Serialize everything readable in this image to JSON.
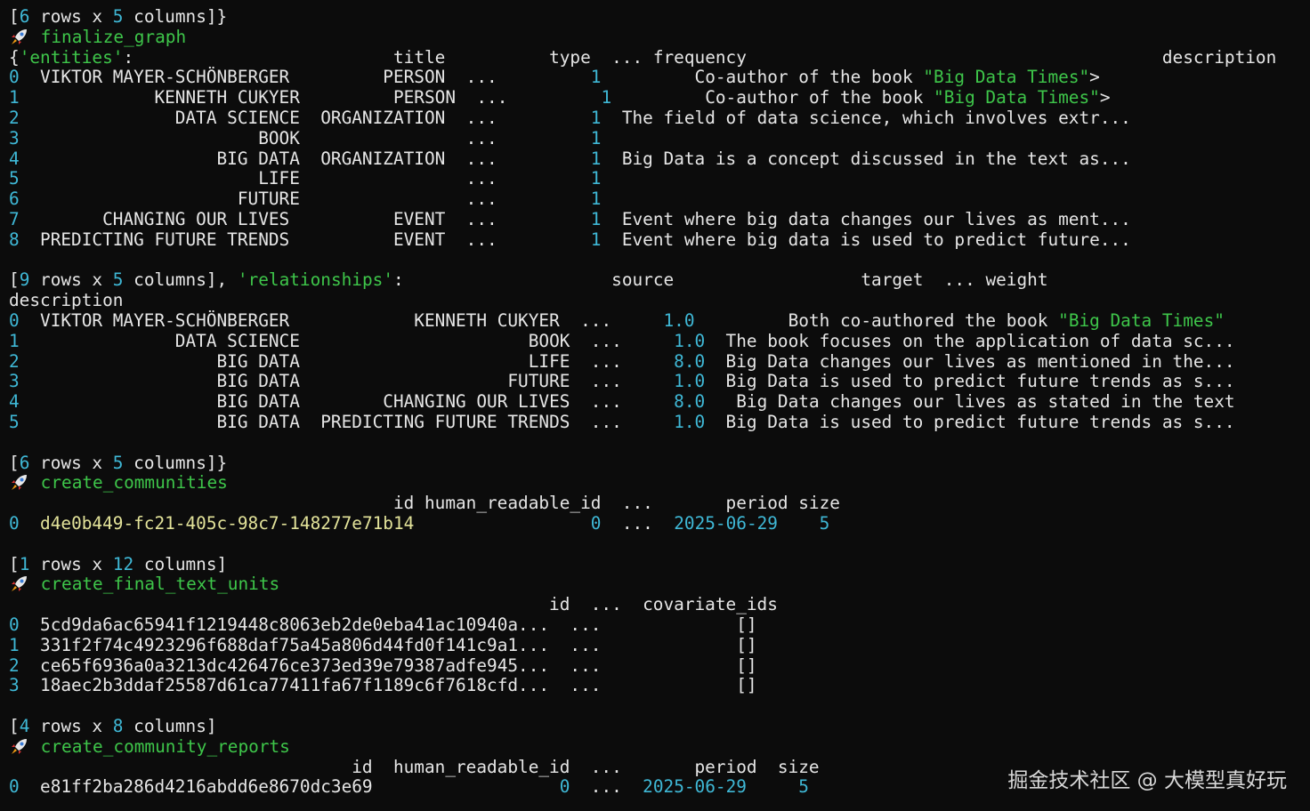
{
  "lines": [
    [
      [
        "d",
        "["
      ],
      [
        "c",
        "6"
      ],
      [
        "d",
        " rows x "
      ],
      [
        "c",
        "5"
      ],
      [
        "d",
        " columns]}"
      ]
    ],
    [
      [
        "icon",
        "rocket-icon"
      ],
      [
        "g",
        " finalize_graph"
      ]
    ],
    [
      [
        "d",
        "{"
      ],
      [
        "g",
        "'entities'"
      ],
      [
        "d",
        ":                         title          type  ... frequency                                        description"
      ]
    ],
    [
      [
        "c",
        "0"
      ],
      [
        "d",
        "  VIKTOR MAYER-SCHÖNBERGER         PERSON  ...         "
      ],
      [
        "c",
        "1"
      ],
      [
        "d",
        "         Co-author of the book "
      ],
      [
        "g",
        "\"Big Data Times\""
      ],
      [
        "d",
        ">"
      ]
    ],
    [
      [
        "c",
        "1"
      ],
      [
        "d",
        "             KENNETH CUKYER         PERSON  ...         "
      ],
      [
        "c",
        "1"
      ],
      [
        "d",
        "         Co-author of the book "
      ],
      [
        "g",
        "\"Big Data Times\""
      ],
      [
        "d",
        ">"
      ]
    ],
    [
      [
        "c",
        "2"
      ],
      [
        "d",
        "               DATA SCIENCE  ORGANIZATION  ...         "
      ],
      [
        "c",
        "1"
      ],
      [
        "d",
        "  The field of data science, which involves extr..."
      ]
    ],
    [
      [
        "c",
        "3"
      ],
      [
        "d",
        "                       BOOK                ...         "
      ],
      [
        "c",
        "1"
      ]
    ],
    [
      [
        "c",
        "4"
      ],
      [
        "d",
        "                   BIG DATA  ORGANIZATION  ...         "
      ],
      [
        "c",
        "1"
      ],
      [
        "d",
        "  Big Data is a concept discussed in the text as..."
      ]
    ],
    [
      [
        "c",
        "5"
      ],
      [
        "d",
        "                       LIFE                ...         "
      ],
      [
        "c",
        "1"
      ]
    ],
    [
      [
        "c",
        "6"
      ],
      [
        "d",
        "                     FUTURE                ...         "
      ],
      [
        "c",
        "1"
      ]
    ],
    [
      [
        "c",
        "7"
      ],
      [
        "d",
        "        CHANGING OUR LIVES          EVENT  ...         "
      ],
      [
        "c",
        "1"
      ],
      [
        "d",
        "  Event where big data changes our lives as ment..."
      ]
    ],
    [
      [
        "c",
        "8"
      ],
      [
        "d",
        "  PREDICTING FUTURE TRENDS          EVENT  ...         "
      ],
      [
        "c",
        "1"
      ],
      [
        "d",
        "  Event where big data is used to predict future..."
      ]
    ],
    [],
    [
      [
        "d",
        "["
      ],
      [
        "c",
        "9"
      ],
      [
        "d",
        " rows x "
      ],
      [
        "c",
        "5"
      ],
      [
        "d",
        " columns], "
      ],
      [
        "g",
        "'relationships'"
      ],
      [
        "d",
        ":                    source                  target  ... weight"
      ]
    ],
    [
      [
        "d",
        "description"
      ]
    ],
    [
      [
        "c",
        "0"
      ],
      [
        "d",
        "  VIKTOR MAYER-SCHÖNBERGER            KENNETH CUKYER  ...     "
      ],
      [
        "c",
        "1.0"
      ],
      [
        "d",
        "         Both co-authored the book "
      ],
      [
        "g",
        "\"Big Data Times\""
      ]
    ],
    [
      [
        "c",
        "1"
      ],
      [
        "d",
        "               DATA SCIENCE                      BOOK  ...     "
      ],
      [
        "c",
        "1.0"
      ],
      [
        "d",
        "  The book focuses on the application of data sc..."
      ]
    ],
    [
      [
        "c",
        "2"
      ],
      [
        "d",
        "                   BIG DATA                      LIFE  ...     "
      ],
      [
        "c",
        "8.0"
      ],
      [
        "d",
        "  Big Data changes our lives as mentioned in the..."
      ]
    ],
    [
      [
        "c",
        "3"
      ],
      [
        "d",
        "                   BIG DATA                    FUTURE  ...     "
      ],
      [
        "c",
        "1.0"
      ],
      [
        "d",
        "  Big Data is used to predict future trends as s..."
      ]
    ],
    [
      [
        "c",
        "4"
      ],
      [
        "d",
        "                   BIG DATA        CHANGING OUR LIVES  ...     "
      ],
      [
        "c",
        "8.0"
      ],
      [
        "d",
        "   Big Data changes our lives as stated in the text"
      ]
    ],
    [
      [
        "c",
        "5"
      ],
      [
        "d",
        "                   BIG DATA  PREDICTING FUTURE TRENDS  ...     "
      ],
      [
        "c",
        "1.0"
      ],
      [
        "d",
        "  Big Data is used to predict future trends as s..."
      ]
    ],
    [],
    [
      [
        "d",
        "["
      ],
      [
        "c",
        "6"
      ],
      [
        "d",
        " rows x "
      ],
      [
        "c",
        "5"
      ],
      [
        "d",
        " columns]}"
      ]
    ],
    [
      [
        "icon",
        "rocket-icon"
      ],
      [
        "g",
        " create_communities"
      ]
    ],
    [
      [
        "d",
        "                                     id human_readable_id  ...       period size"
      ]
    ],
    [
      [
        "c",
        "0"
      ],
      [
        "d",
        "  "
      ],
      [
        "y",
        "d4e0b449-fc21-405c-98c7-148277e71b14"
      ],
      [
        "d",
        "                 "
      ],
      [
        "c",
        "0"
      ],
      [
        "d",
        "  ...  "
      ],
      [
        "c",
        "2025-06-29"
      ],
      [
        "d",
        "    "
      ],
      [
        "c",
        "5"
      ]
    ],
    [],
    [
      [
        "d",
        "["
      ],
      [
        "c",
        "1"
      ],
      [
        "d",
        " rows x "
      ],
      [
        "c",
        "12"
      ],
      [
        "d",
        " columns]"
      ]
    ],
    [
      [
        "icon",
        "rocket-icon"
      ],
      [
        "g",
        " create_final_text_units"
      ]
    ],
    [
      [
        "d",
        "                                                    id  ...  covariate_ids"
      ]
    ],
    [
      [
        "c",
        "0"
      ],
      [
        "d",
        "  5cd9da6ac65941f1219448c8063eb2de0eba41ac10940a...  ...             []"
      ]
    ],
    [
      [
        "c",
        "1"
      ],
      [
        "d",
        "  331f2f74c4923296f688daf75a45a806d44fd0f141c9a1...  ...             []"
      ]
    ],
    [
      [
        "c",
        "2"
      ],
      [
        "d",
        "  ce65f6936a0a3213dc426476ce373ed39e79387adfe945...  ...             []"
      ]
    ],
    [
      [
        "c",
        "3"
      ],
      [
        "d",
        "  18aec2b3ddaf25587d61ca77411fa67f1189c6f7618cfd...  ...             []"
      ]
    ],
    [],
    [
      [
        "d",
        "["
      ],
      [
        "c",
        "4"
      ],
      [
        "d",
        " rows x "
      ],
      [
        "c",
        "8"
      ],
      [
        "d",
        " columns]"
      ]
    ],
    [
      [
        "icon",
        "rocket-icon"
      ],
      [
        "g",
        " create_community_reports"
      ]
    ],
    [
      [
        "d",
        "                                 id  human_readable_id  ...       period  size"
      ]
    ],
    [
      [
        "c",
        "0"
      ],
      [
        "d",
        "  e81ff2ba286d4216abdd6e8670dc3e69                  "
      ],
      [
        "c",
        "0"
      ],
      [
        "d",
        "  ...  "
      ],
      [
        "c",
        "2025-06-29"
      ],
      [
        "d",
        "     "
      ],
      [
        "c",
        "5"
      ]
    ]
  ],
  "watermark": "掘金技术社区 @ 大模型真好玩"
}
